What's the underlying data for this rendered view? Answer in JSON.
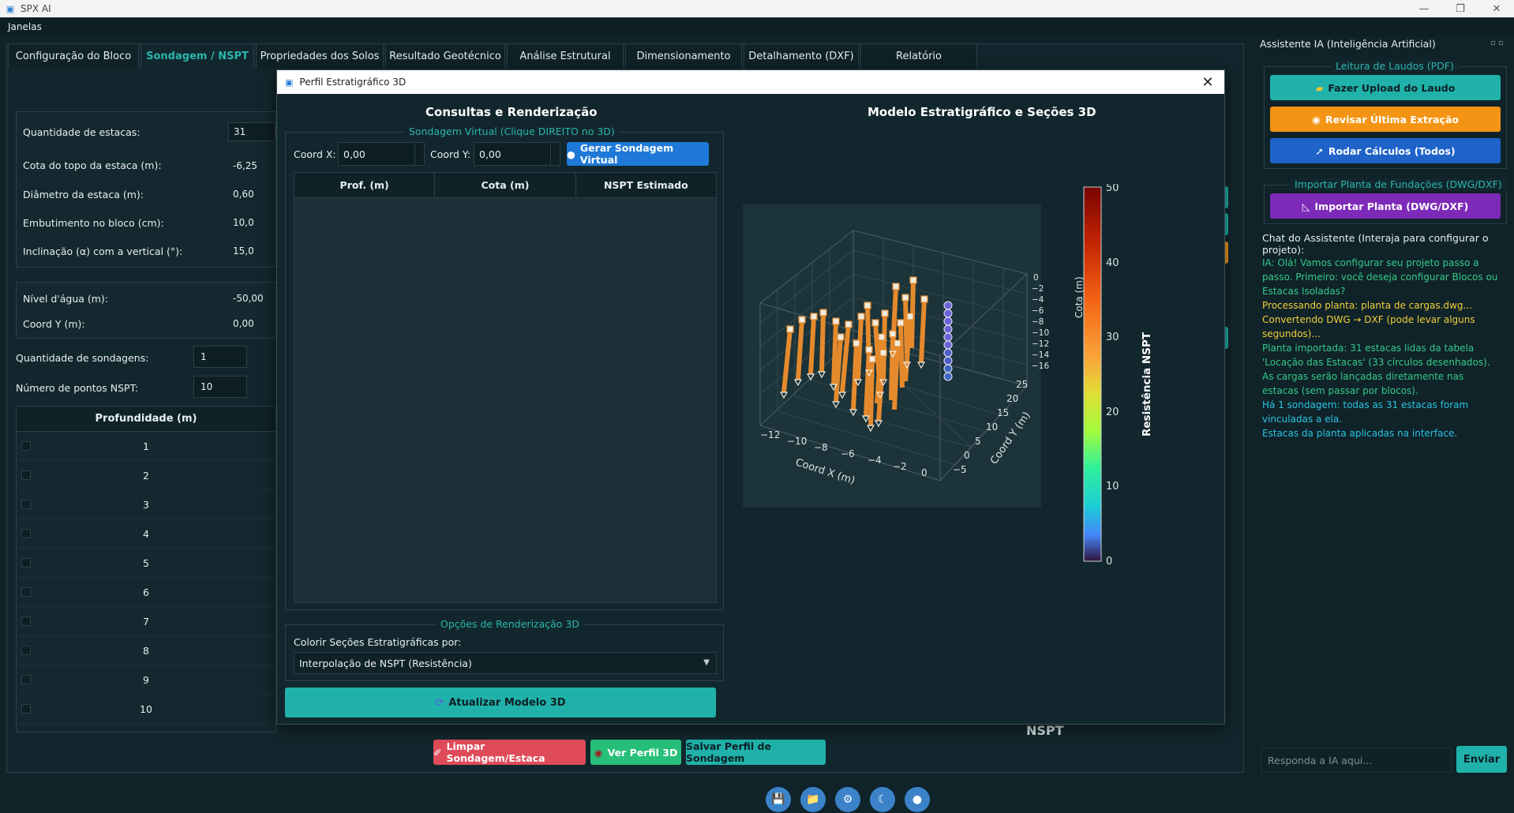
{
  "window": {
    "title": "SPX AI",
    "min": "—",
    "max": "❐",
    "close": "✕"
  },
  "menu": {
    "item": "Janelas"
  },
  "tabs": [
    {
      "label": "Configuração do Bloco",
      "active": false
    },
    {
      "label": "Sondagem / NSPT",
      "active": true
    },
    {
      "label": "Propriedades dos Solos",
      "active": false
    },
    {
      "label": "Resultado Geotécnico",
      "active": false
    },
    {
      "label": "Análise Estrutural",
      "active": false
    },
    {
      "label": "Dimensionamento",
      "active": false
    },
    {
      "label": "Detalhamento (DXF)",
      "active": false
    },
    {
      "label": "Relatório",
      "active": false
    }
  ],
  "form": {
    "qtd_estacas": {
      "label": "Quantidade de estacas:",
      "value": "31"
    },
    "cota_topo": {
      "label": "Cota do topo da estaca (m):",
      "value": "-6,25"
    },
    "diametro": {
      "label": "Diâmetro da estaca (m):",
      "value": "0,60"
    },
    "embutimento": {
      "label": "Embutimento no bloco (cm):",
      "value": "10,0"
    },
    "inclinacao": {
      "label": "Inclinação (α) com a vertical (°):",
      "value": "15,0"
    },
    "nivel_agua": {
      "label": "Nível d'água (m):",
      "value": "-50,00"
    },
    "coord_y": {
      "label": "Coord Y (m):",
      "value": "0,00"
    },
    "qtd_sondagens": {
      "label": "Quantidade de sondagens:",
      "value": "1"
    },
    "pontos_nspt": {
      "label": "Número de pontos NSPT:",
      "value": "10"
    }
  },
  "depth_table": {
    "header": "Profundidade (m)",
    "rows": [
      "1",
      "2",
      "3",
      "4",
      "5",
      "6",
      "7",
      "8",
      "9",
      "10"
    ]
  },
  "bottom_buttons": {
    "limpar": "Limpar Sondagem/Estaca",
    "ver": "Ver Perfil 3D",
    "salvar": "Salvar Perfil de Sondagem"
  },
  "bg_label_nspt": "NSPT",
  "dialog": {
    "title": "Perfil Estratigráfico 3D",
    "left_title": "Consultas e Renderização",
    "virtual_group": "Sondagem Virtual (Clique DIREITO no 3D)",
    "coord_x_label": "Coord X:",
    "coord_x_value": "0,00",
    "coord_y_label": "Coord Y:",
    "coord_y_value": "0,00",
    "generate_btn": "Gerar Sondagem Virtual",
    "table_headers": [
      "Prof. (m)",
      "Cota (m)",
      "NSPT Estimado"
    ],
    "render_group": "Opções de Renderização 3D",
    "color_by_label": "Colorir Seções Estratigráficas por:",
    "color_by_value": "Interpolação de NSPT (Resistência)",
    "update_btn": "Atualizar Modelo 3D",
    "right_title": "Modelo Estratigráfico e Seções 3D"
  },
  "plot3d": {
    "xlabel": "Coord X (m)",
    "ylabel": "Coord Y (m)",
    "zlabel": "Cota (m)",
    "x_ticks": [
      "−12",
      "−10",
      "−8",
      "−6",
      "−4",
      "−2",
      "0"
    ],
    "y_ticks": [
      "−5",
      "0",
      "5",
      "10",
      "15",
      "20",
      "25"
    ],
    "z_ticks": [
      "0",
      "−2",
      "−4",
      "−6",
      "−8",
      "−10",
      "−12",
      "−14",
      "−16"
    ],
    "colorbar_label": "Resistência NSPT",
    "colorbar_ticks": [
      "50",
      "40",
      "30",
      "20",
      "10",
      "0"
    ],
    "pile_color": "#e58a2c",
    "probe_color": "#6a63d8"
  },
  "right_panel": {
    "header": "Assistente IA (Inteligência Artificial)",
    "laudos_group": "Leitura de Laudos (PDF)",
    "upload_btn": "Fazer Upload do Laudo",
    "revisar_btn": "Revisar Última Extração",
    "rodar_btn": "Rodar Cálculos (Todos)",
    "importar_group": "Importar Planta de Fundações (DWG/DXF)",
    "importar_btn": "Importar Planta (DWG/DXF)",
    "chat_label": "Chat do Assistente (Interaja para configurar o projeto):",
    "messages": [
      {
        "text": "IA: Olá! Vamos configurar seu projeto passo a passo. Primeiro: você deseja configurar Blocos ou Estacas Isoladas?",
        "color": "#36c98a"
      },
      {
        "text": "Processando planta: planta de cargas.dwg...",
        "color": "#f2cf3a"
      },
      {
        "text": "Convertendo DWG → DXF (pode levar alguns segundos)...",
        "color": "#f2cf3a"
      },
      {
        "text": "Planta importada: 31 estacas lidas da tabela 'Locação das Estacas' (33 círculos desenhados). As cargas serão lançadas diretamente nas estacas (sem passar por blocos).",
        "color": "#36c98a"
      },
      {
        "text": "Há 1 sondagem: todas as 31 estacas foram vinculadas a ela.",
        "color": "#2bc3e0"
      },
      {
        "text": "Estacas da planta aplicadas na interface.",
        "color": "#2bc3e0"
      }
    ],
    "chat_placeholder": "Responda a IA aqui...",
    "send_btn": "Enviar"
  }
}
